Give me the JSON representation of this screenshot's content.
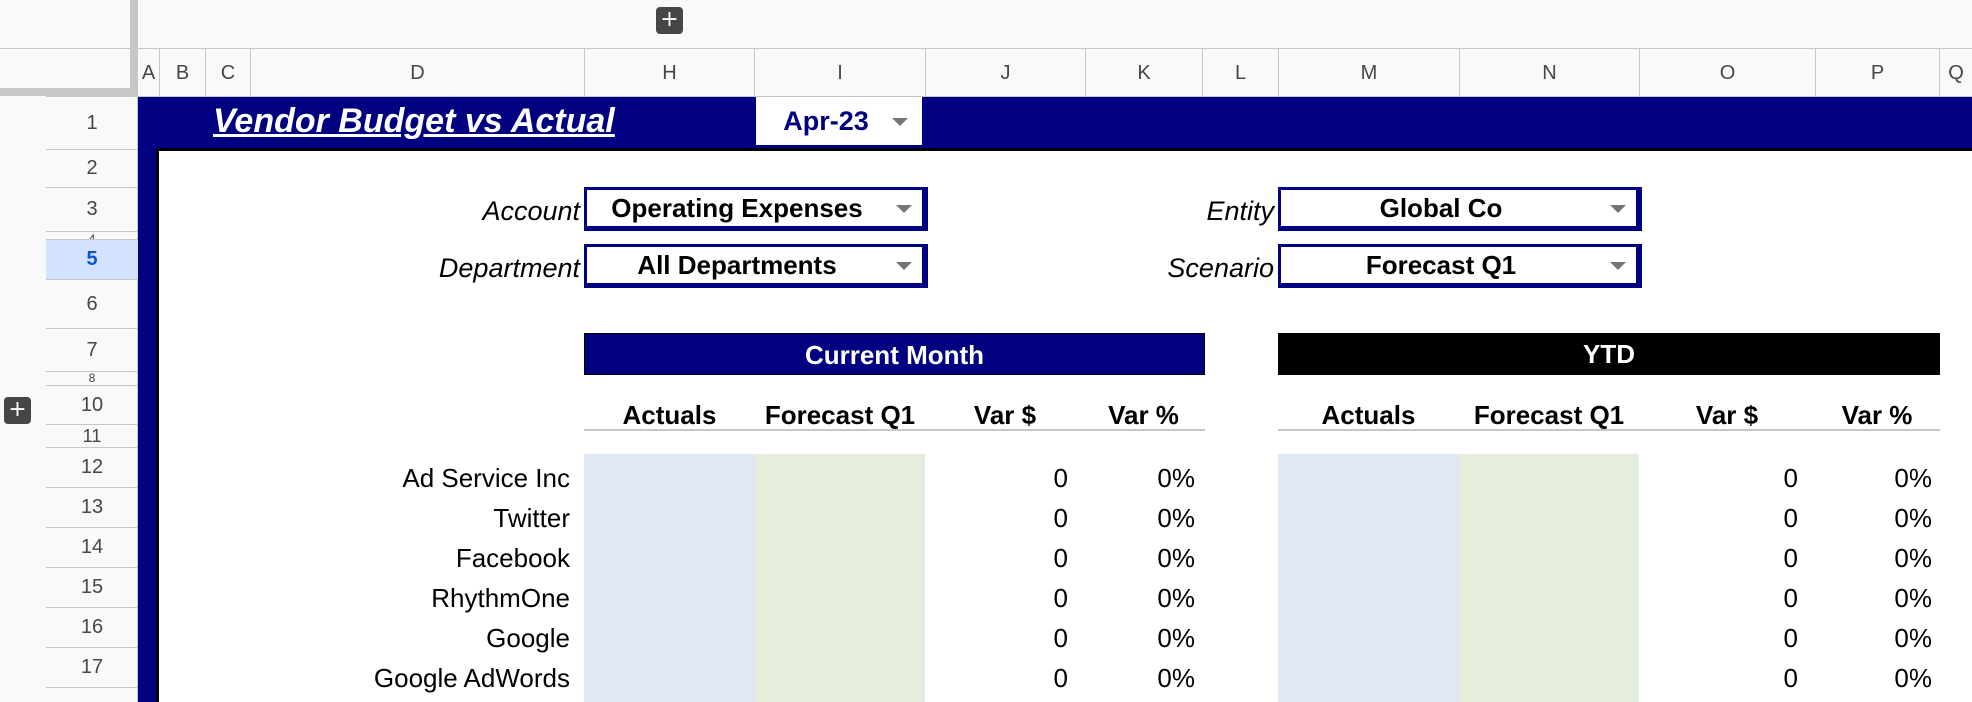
{
  "column_headers": [
    "A",
    "B",
    "C",
    "D",
    "H",
    "I",
    "J",
    "K",
    "L",
    "M",
    "N",
    "O",
    "P",
    "Q"
  ],
  "row_headers": [
    "1",
    "2",
    "3",
    "4",
    "5",
    "6",
    "7",
    "8",
    "10",
    "11",
    "12",
    "13",
    "14",
    "15",
    "16",
    "17"
  ],
  "selected_row": "5",
  "title": "Vendor Budget vs Actual",
  "month": "Apr-23",
  "filters": {
    "account": {
      "label": "Account",
      "value": "Operating Expenses"
    },
    "department": {
      "label": "Department",
      "value": "All Departments"
    },
    "entity": {
      "label": "Entity",
      "value": "Global Co"
    },
    "scenario": {
      "label": "Scenario",
      "value": "Forecast Q1"
    }
  },
  "sections": {
    "current": {
      "title": "Current Month",
      "color": "#000080",
      "headers": [
        "Actuals",
        "Forecast Q1",
        "Var $",
        "Var %"
      ]
    },
    "ytd": {
      "title": "YTD",
      "color": "#000000",
      "headers": [
        "Actuals",
        "Forecast Q1",
        "Var $",
        "Var %"
      ]
    }
  },
  "vendors": [
    {
      "name": "Ad Service Inc",
      "cm_var": "0",
      "cm_pct": "0%",
      "ytd_var": "0",
      "ytd_pct": "0%"
    },
    {
      "name": "Twitter",
      "cm_var": "0",
      "cm_pct": "0%",
      "ytd_var": "0",
      "ytd_pct": "0%"
    },
    {
      "name": "Facebook",
      "cm_var": "0",
      "cm_pct": "0%",
      "ytd_var": "0",
      "ytd_pct": "0%"
    },
    {
      "name": "RhythmOne",
      "cm_var": "0",
      "cm_pct": "0%",
      "ytd_var": "0",
      "ytd_pct": "0%"
    },
    {
      "name": "Google",
      "cm_var": "0",
      "cm_pct": "0%",
      "ytd_var": "0",
      "ytd_pct": "0%"
    },
    {
      "name": "Google AdWords",
      "cm_var": "0",
      "cm_pct": "0%",
      "ytd_var": "0",
      "ytd_pct": "0%"
    }
  ],
  "colors": {
    "navy": "#000080",
    "actuals_fill": "#e1e8f5",
    "forecast_fill": "#e5eedd",
    "selection": "#d3e3fd"
  },
  "icons": {
    "add_column": "plus-icon",
    "add_row": "plus-icon",
    "dropdown": "caret-down-icon"
  }
}
